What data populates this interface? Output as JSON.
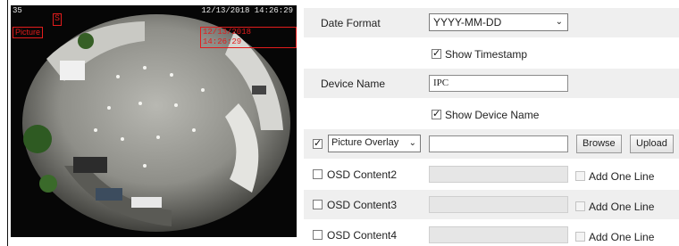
{
  "preview": {
    "channel_number": "35",
    "top_timestamp": "12/13/2018 14:26:29",
    "s_box": "S",
    "picture_label": "Picture",
    "osd_timestamp": "12/13/2018 14:26:29"
  },
  "form": {
    "date_format": {
      "label": "Date Format",
      "value": "YYYY-MM-DD"
    },
    "show_timestamp": {
      "label": "Show Timestamp",
      "checked": true
    },
    "device_name": {
      "label": "Device Name",
      "value": "IPC"
    },
    "show_device_name": {
      "label": "Show Device Name",
      "checked": true
    },
    "picture_overlay": {
      "select_value": "Picture Overlay",
      "browse_label": "Browse",
      "upload_label": "Upload",
      "checked": true
    },
    "osd_rows": [
      {
        "label": "OSD Content2",
        "add_line_label": "Add One Line"
      },
      {
        "label": "OSD Content3",
        "add_line_label": "Add One Line"
      },
      {
        "label": "OSD Content4",
        "add_line_label": "Add One Line"
      }
    ]
  },
  "colors": {
    "osd_red": "#e21c1c",
    "row_gray": "#efefef"
  }
}
